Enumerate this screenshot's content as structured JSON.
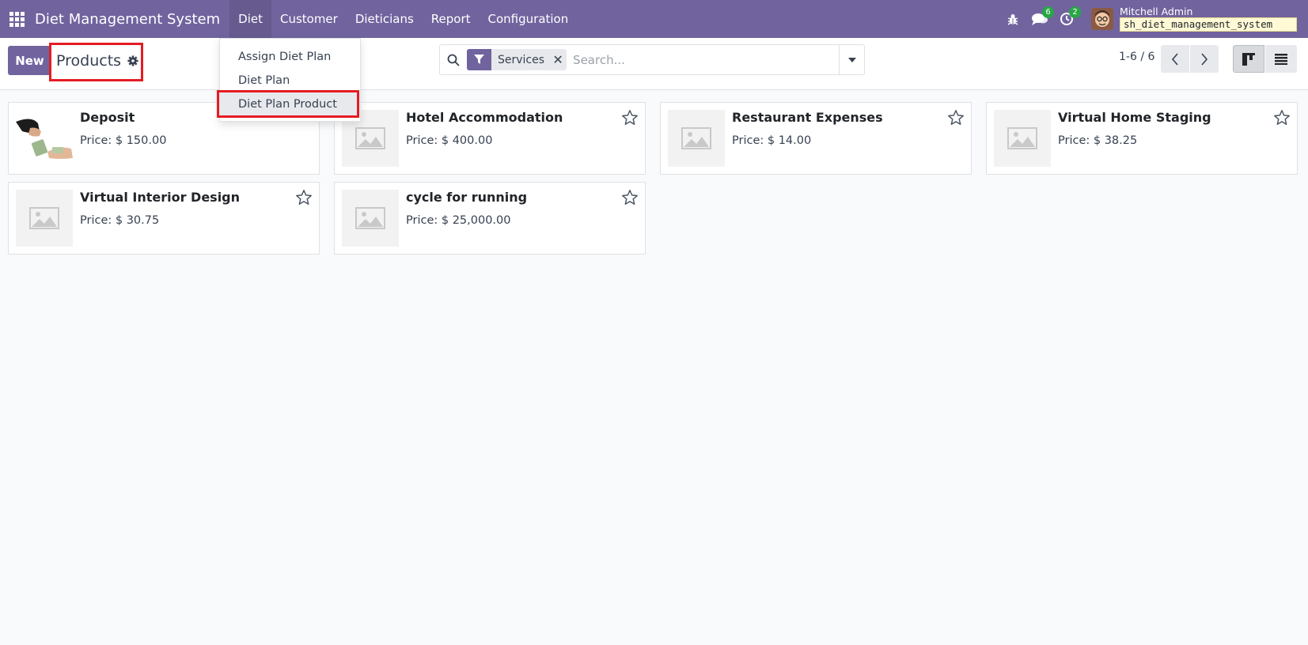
{
  "navbar": {
    "app_title": "Diet Management System",
    "menu": [
      "Diet",
      "Customer",
      "Dieticians",
      "Report",
      "Configuration"
    ],
    "active_menu": "Diet",
    "messages_badge": "6",
    "activities_badge": "2",
    "user_name": "Mitchell Admin",
    "db_name": "sh_diet_management_system"
  },
  "control_panel": {
    "new_label": "New",
    "page_title": "Products",
    "facet_label": "Services",
    "search_placeholder": "Search...",
    "pager": "1-6 / 6"
  },
  "dropdown": {
    "items": [
      "Assign Diet Plan",
      "Diet Plan",
      "Diet Plan Product"
    ],
    "focused_item": "Diet Plan Product"
  },
  "products": [
    {
      "name": "Deposit",
      "price": "Price: $ 150.00",
      "image": "photo"
    },
    {
      "name": "Hotel Accommodation",
      "price": "Price: $ 400.00",
      "image": "placeholder"
    },
    {
      "name": "Restaurant Expenses",
      "price": "Price: $ 14.00",
      "image": "placeholder"
    },
    {
      "name": "Virtual Home Staging",
      "price": "Price: $ 38.25",
      "image": "placeholder"
    },
    {
      "name": "Virtual Interior Design",
      "price": "Price: $ 30.75",
      "image": "placeholder"
    },
    {
      "name": "cycle for running",
      "price": "Price: $ 25,000.00",
      "image": "placeholder"
    }
  ],
  "colors": {
    "brand": "#71639e",
    "badge": "#28a745",
    "highlight": "#e51c23"
  }
}
